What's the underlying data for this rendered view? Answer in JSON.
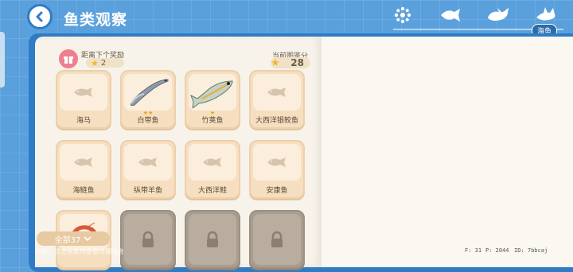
{
  "header": {
    "title": "鱼类观察"
  },
  "tabs": [
    {
      "icon": "dots-icon",
      "label": ""
    },
    {
      "icon": "fish-icon",
      "label": ""
    },
    {
      "icon": "whale-icon",
      "label": ""
    },
    {
      "icon": "shark-icon",
      "label": "海鱼",
      "active": true
    }
  ],
  "reward": {
    "label": "距离下个奖励",
    "value": "2"
  },
  "score": {
    "label": "当前图鉴分",
    "value": "28"
  },
  "cards": [
    {
      "name": "海马",
      "stars": "",
      "state": "unknown"
    },
    {
      "name": "白带鱼",
      "stars": "★★",
      "state": "found"
    },
    {
      "name": "竹荚鱼",
      "stars": "★",
      "state": "found"
    },
    {
      "name": "大西洋银鲛鱼",
      "stars": "",
      "state": "unknown"
    },
    {
      "name": "海鲢鱼",
      "stars": "",
      "state": "unknown"
    },
    {
      "name": "纵带羊鱼",
      "stars": "",
      "state": "unknown"
    },
    {
      "name": "大西洋鲑",
      "stars": "",
      "state": "unknown"
    },
    {
      "name": "安康鱼",
      "stars": "",
      "state": "unknown"
    },
    {
      "name": "",
      "stars": "",
      "state": "found-shrimp"
    },
    {
      "name": "",
      "stars": "",
      "state": "locked"
    },
    {
      "name": "",
      "stars": "",
      "state": "locked"
    },
    {
      "name": "",
      "stars": "",
      "state": "locked"
    }
  ],
  "filter": {
    "label": "全部37"
  },
  "footer": {
    "note": "提示：点击鱼类可查看详细信息",
    "debug": [
      "F: 31",
      "P: 2044",
      "ID: 7bbcaj"
    ]
  }
}
